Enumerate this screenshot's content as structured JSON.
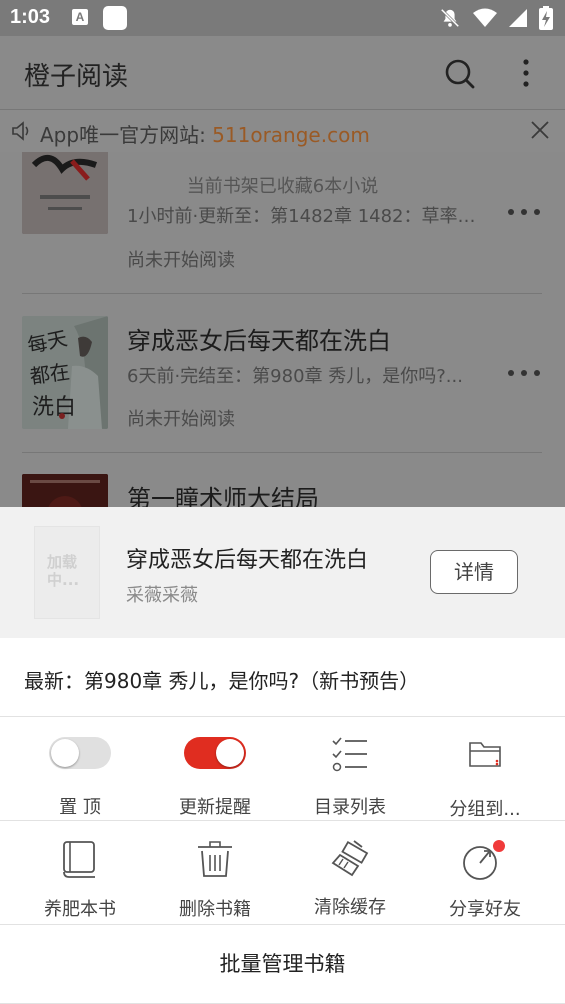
{
  "status_bar": {
    "time": "1:03",
    "notif_letter": "A"
  },
  "app": {
    "title": "橙子阅读"
  },
  "notice": {
    "prefix": "App唯一官方网站: ",
    "url": "511orange.com"
  },
  "shelf": {
    "count_text": "当前书架已收藏6本小说",
    "books": [
      {
        "title": "",
        "update": "1小时前·更新至：第1482章 1482：草率了...",
        "status": "尚未开始阅读"
      },
      {
        "title": "穿成恶女后每天都在洗白",
        "update": "6天前·完结至：第980章 秀儿，是你吗?...",
        "status": "尚未开始阅读"
      },
      {
        "title": "第一瞳术师大结局",
        "update": "",
        "status": ""
      }
    ]
  },
  "sheet": {
    "cover_placeholder": "加载中...",
    "title": "穿成恶女后每天都在洗白",
    "author": "采薇采薇",
    "detail_label": "详情",
    "latest": "最新：第980章 秀儿，是你吗?（新书预告）",
    "row1": [
      {
        "label": "置 顶",
        "toggle": "off"
      },
      {
        "label": "更新提醒",
        "toggle": "on"
      },
      {
        "label": "目录列表"
      },
      {
        "label": "分组到..."
      }
    ],
    "row2": [
      {
        "label": "养肥本书"
      },
      {
        "label": "删除书籍"
      },
      {
        "label": "清除缓存"
      },
      {
        "label": "分享好友"
      }
    ],
    "batch_label": "批量管理书籍"
  },
  "colors": {
    "accent_red": "#e02d20",
    "url_orange": "#9a5a25",
    "dim_overlay": "#8a8a8a"
  }
}
